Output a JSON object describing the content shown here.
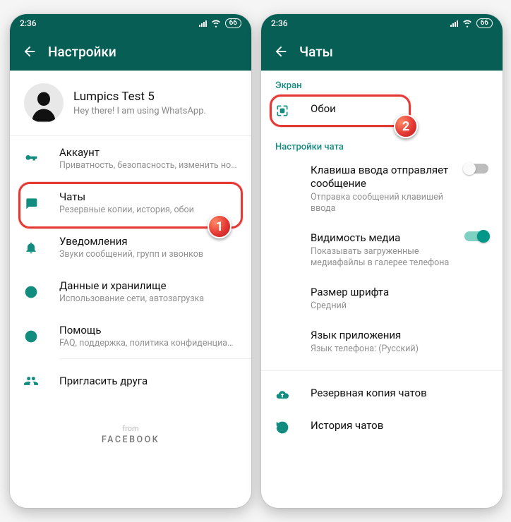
{
  "statusbar": {
    "time": "2:36",
    "battery": "66"
  },
  "left": {
    "appbar_title": "Настройки",
    "profile": {
      "name": "Lumpics Test 5",
      "status": "Hey there! I am using WhatsApp."
    },
    "items": [
      {
        "title": "Аккаунт",
        "sub": "Приватность, безопасность, изменить номер"
      },
      {
        "title": "Чаты",
        "sub": "Резервные копии, история, обои"
      },
      {
        "title": "Уведомления",
        "sub": "Звуки сообщений, групп и звонков"
      },
      {
        "title": "Данные и хранилище",
        "sub": "Использование сети, автозагрузка"
      },
      {
        "title": "Помощь",
        "sub": "FAQ, поддержка, политика конфиденциальн..."
      },
      {
        "title": "Пригласить друга",
        "sub": ""
      }
    ],
    "from": "from",
    "facebook": "FACEBOOK"
  },
  "right": {
    "appbar_title": "Чаты",
    "section_screen": "Экран",
    "wallpaper": {
      "title": "Обои"
    },
    "section_chat": "Настройки чата",
    "enter_send": {
      "title": "Клавиша ввода отправляет сообщение",
      "sub": "Отправка сообщений клавишей ввода"
    },
    "media_vis": {
      "title": "Видимость медиа",
      "sub": "Показывать загруженные медиафайлы в галерее телефона"
    },
    "font_size": {
      "title": "Размер шрифта",
      "sub": "Средний"
    },
    "app_lang": {
      "title": "Язык приложения",
      "sub": "Язык телефона: (Русский)"
    },
    "backup": {
      "title": "Резервная копия чатов"
    },
    "history": {
      "title": "История чатов"
    }
  },
  "badges": {
    "one": "1",
    "two": "2"
  }
}
